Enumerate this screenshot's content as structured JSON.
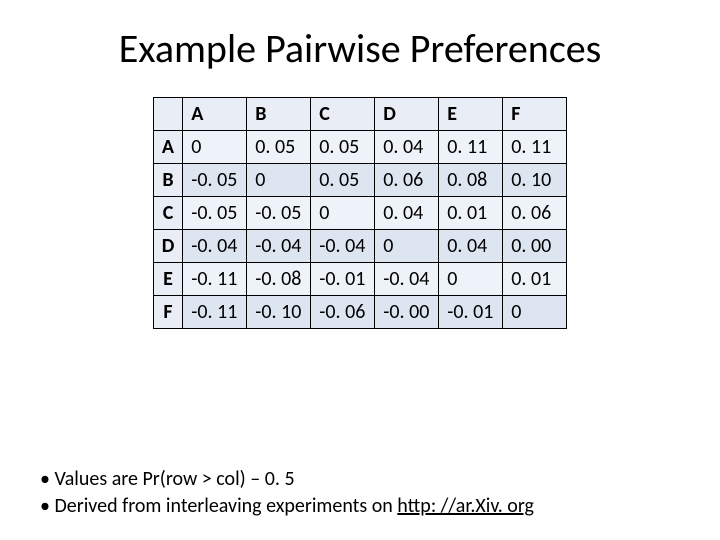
{
  "title": "Example Pairwise Preferences",
  "headers": [
    "A",
    "B",
    "C",
    "D",
    "E",
    "F"
  ],
  "row_labels": [
    "A",
    "B",
    "C",
    "D",
    "E",
    "F"
  ],
  "cells": [
    [
      "0",
      "0. 05",
      "0. 05",
      "0. 04",
      "0. 11",
      "0. 11"
    ],
    [
      "-0. 05",
      "0",
      "0. 05",
      "0. 06",
      "0. 08",
      "0. 10"
    ],
    [
      "-0. 05",
      "-0. 05",
      "0",
      "0. 04",
      "0. 01",
      "0. 06"
    ],
    [
      "-0. 04",
      "-0. 04",
      "-0. 04",
      "0",
      "0. 04",
      "0. 00"
    ],
    [
      "-0. 11",
      "-0. 08",
      "-0. 01",
      "-0. 04",
      "0",
      "0. 01"
    ],
    [
      "-0. 11",
      "-0. 10",
      "-0. 06",
      "-0. 00",
      "-0. 01",
      "0"
    ]
  ],
  "notes": {
    "line1_pre": "Values are Pr(row > col) – 0. 5",
    "line2_pre": "Derived from interleaving experiments on ",
    "line2_link": "http: //ar.Xiv. org"
  },
  "chart_data": {
    "type": "table",
    "title": "Example Pairwise Preferences",
    "row_labels": [
      "A",
      "B",
      "C",
      "D",
      "E",
      "F"
    ],
    "col_labels": [
      "A",
      "B",
      "C",
      "D",
      "E",
      "F"
    ],
    "values": [
      [
        0.0,
        0.05,
        0.05,
        0.04,
        0.11,
        0.11
      ],
      [
        -0.05,
        0.0,
        0.05,
        0.06,
        0.08,
        0.1
      ],
      [
        -0.05,
        -0.05,
        0.0,
        0.04,
        0.01,
        0.06
      ],
      [
        -0.04,
        -0.04,
        -0.04,
        0.0,
        0.04,
        0.0
      ],
      [
        -0.11,
        -0.08,
        -0.01,
        -0.04,
        0.0,
        0.01
      ],
      [
        -0.11,
        -0.1,
        -0.06,
        0.0,
        -0.01,
        0.0
      ]
    ],
    "note": "Values are Pr(row > col) - 0.5; derived from interleaving experiments on arXiv.org"
  }
}
